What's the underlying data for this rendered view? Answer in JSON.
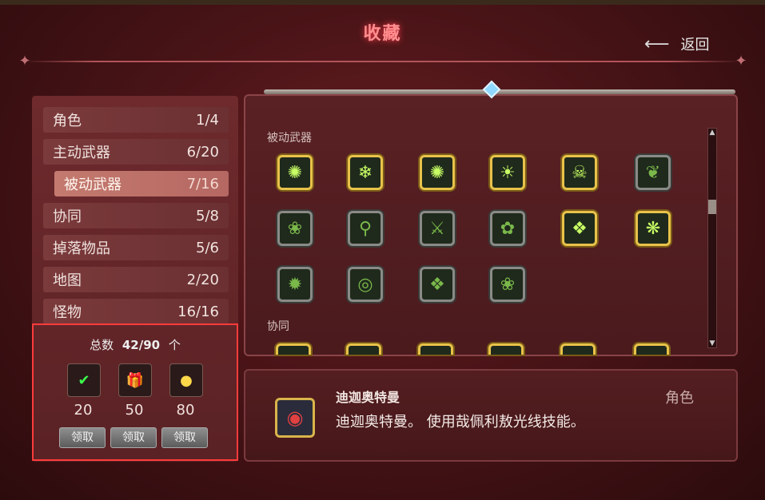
{
  "header": {
    "title": "收藏",
    "back_label": "返回"
  },
  "categories": [
    {
      "label": "角色",
      "count": "1/4"
    },
    {
      "label": "主动武器",
      "count": "6/20"
    },
    {
      "label": "被动武器",
      "count": "7/16",
      "active": true
    },
    {
      "label": "协同",
      "count": "5/8"
    },
    {
      "label": "掉落物品",
      "count": "5/6"
    },
    {
      "label": "地图",
      "count": "2/20"
    },
    {
      "label": "怪物",
      "count": "16/16"
    }
  ],
  "rewards": {
    "total_label": "总数",
    "total_value": "42/90",
    "total_unit": "个",
    "items": [
      {
        "threshold": "20",
        "icon": "check-reward-icon",
        "claim_label": "领取"
      },
      {
        "threshold": "50",
        "icon": "gift-reward-icon",
        "claim_label": "领取"
      },
      {
        "threshold": "80",
        "icon": "coin-reward-icon",
        "claim_label": "领取"
      }
    ],
    "highlight_color": "#ff3b3b"
  },
  "collection": {
    "section_passive": "被动武器",
    "section_synergy": "协同",
    "passive_items": [
      {
        "icon": "burst-icon",
        "unlocked": true
      },
      {
        "icon": "snowflake-icon",
        "unlocked": true
      },
      {
        "icon": "burst-icon",
        "unlocked": true
      },
      {
        "icon": "sun-icon",
        "unlocked": true
      },
      {
        "icon": "skull-icon",
        "unlocked": true
      },
      {
        "icon": "leaf-icon",
        "unlocked": false
      },
      {
        "icon": "claw-icon",
        "unlocked": false
      },
      {
        "icon": "magnifier-icon",
        "unlocked": false
      },
      {
        "icon": "sword-icon",
        "unlocked": false
      },
      {
        "icon": "frog-icon",
        "unlocked": false
      },
      {
        "icon": "revolver-icon",
        "unlocked": true
      },
      {
        "icon": "circuit-icon",
        "unlocked": true
      },
      {
        "icon": "cookie-icon",
        "unlocked": false
      },
      {
        "icon": "coin-icon",
        "unlocked": false
      },
      {
        "icon": "blade-icon",
        "unlocked": false
      },
      {
        "icon": "bug-icon",
        "unlocked": false
      }
    ]
  },
  "detail": {
    "name": "迪迦奥特曼",
    "description": "迪迦奥特曼。 使用哉佩利敖光线技能。",
    "type": "角色"
  },
  "colors": {
    "gold": "#e8c24a",
    "accent_red": "#ff8f8f"
  }
}
